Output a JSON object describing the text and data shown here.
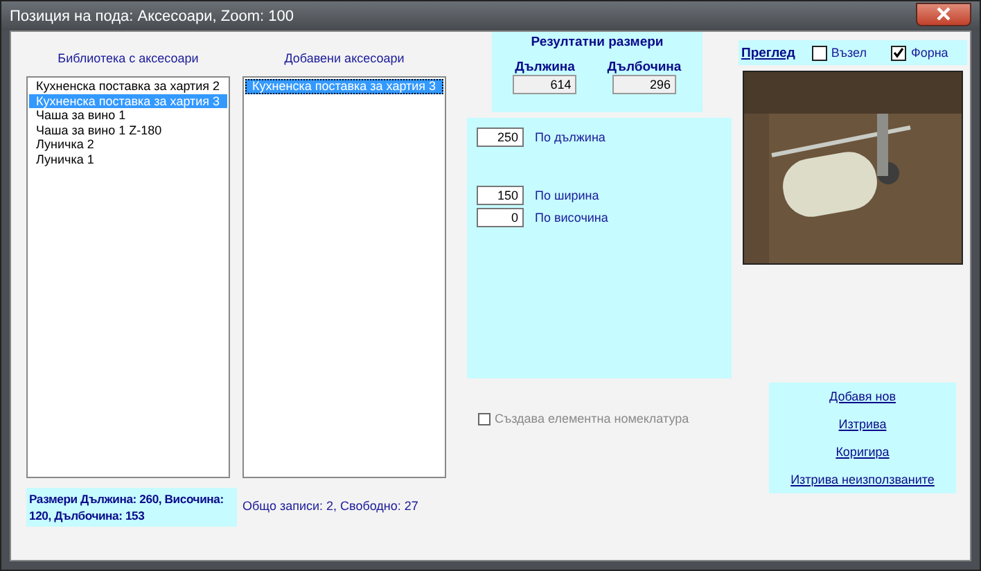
{
  "window": {
    "title": "Позиция на пода: Аксесоари,  Zoom: 100"
  },
  "library": {
    "label": "Библиотека с аксесоари",
    "items": [
      {
        "text": "Кухненска поставка за хартия 2",
        "selected": false
      },
      {
        "text": "Кухненска поставка за хартия 3",
        "selected": true
      },
      {
        "text": "Чаша за вино 1",
        "selected": false
      },
      {
        "text": "Чаша за вино 1 Z-180",
        "selected": false
      },
      {
        "text": "Луничка 2",
        "selected": false
      },
      {
        "text": "Луничка 1",
        "selected": false
      }
    ]
  },
  "added": {
    "label": "Добавени аксесоари",
    "items": [
      {
        "text": "Кухненска поставка за хартия 3",
        "selected": true
      }
    ]
  },
  "dimensions_summary": "Размери Дължина: 260, Височина: 120, Дълбочина: 153",
  "records_summary": "Общо записи: 2, Свободно: 27",
  "results": {
    "title": "Резултатни размери",
    "fields": [
      {
        "label": "Дължина",
        "value": "614"
      },
      {
        "label": "Дълбочина",
        "value": "296"
      }
    ]
  },
  "offsets": [
    {
      "value": "250",
      "label": "По дължина"
    },
    {
      "value": "150",
      "label": "По ширина"
    },
    {
      "value": "0",
      "label": "По височина"
    }
  ],
  "nomenclature": {
    "label": "Създава елементна номеклатура",
    "checked": false,
    "disabled": true
  },
  "preview": {
    "title": "Преглед",
    "options": [
      {
        "label": "Възел",
        "checked": false
      },
      {
        "label": "Форна",
        "checked": true
      }
    ]
  },
  "actions": [
    "Добавя нов",
    "Изтрива",
    "Коригира",
    "Изтрива неизползваните"
  ]
}
